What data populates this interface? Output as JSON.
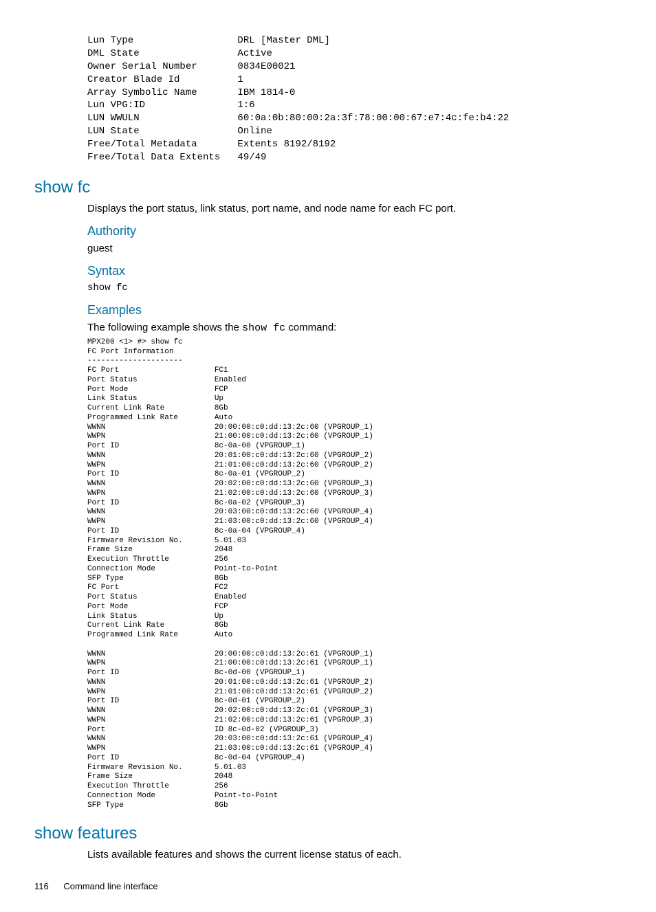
{
  "top_block": "Lun Type                  DRL [Master DML]\nDML State                 Active\nOwner Serial Number       0834E00021\nCreator Blade Id          1\nArray Symbolic Name       IBM 1814-0\nLun VPG:ID                1:6\nLUN WWULN                 60:0a:0b:80:00:2a:3f:78:00:00:67:e7:4c:fe:b4:22\nLUN State                 Online\nFree/Total Metadata       Extents 8192/8192\nFree/Total Data Extents   49/49",
  "show_fc": {
    "heading": "show fc",
    "desc": "Displays the port status, link status, port name, and node name for each FC port.",
    "authority_h": "Authority",
    "authority_v": "guest",
    "syntax_h": "Syntax",
    "syntax_v": "show fc",
    "examples_h": "Examples",
    "examples_intro_pre": "The following example shows the ",
    "examples_intro_code": "show fc",
    "examples_intro_post": " command:",
    "example_block": "MPX200 <1> #> show fc\nFC Port Information\n---------------------\nFC Port                     FC1\nPort Status                 Enabled\nPort Mode                   FCP\nLink Status                 Up\nCurrent Link Rate           8Gb\nProgrammed Link Rate        Auto\nWWNN                        20:00:00:c0:dd:13:2c:60 (VPGROUP_1)\nWWPN                        21:00:00:c0:dd:13:2c:60 (VPGROUP_1)\nPort ID                     8c-0a-00 (VPGROUP_1)\nWWNN                        20:01:00:c0:dd:13:2c:60 (VPGROUP_2)\nWWPN                        21:01:00:c0:dd:13:2c:60 (VPGROUP_2)\nPort ID                     8c-0a-01 (VPGROUP_2)\nWWNN                        20:02:00:c0:dd:13:2c:60 (VPGROUP_3)\nWWPN                        21:02:00:c0:dd:13:2c:60 (VPGROUP_3)\nPort ID                     8c-0a-02 (VPGROUP_3)\nWWNN                        20:03:00:c0:dd:13:2c:60 (VPGROUP_4)\nWWPN                        21:03:00:c0:dd:13:2c:60 (VPGROUP_4)\nPort ID                     8c-0a-04 (VPGROUP_4)\nFirmware Revision No.       5.01.03\nFrame Size                  2048\nExecution Throttle          256\nConnection Mode             Point-to-Point\nSFP Type                    8Gb\nFC Port                     FC2\nPort Status                 Enabled\nPort Mode                   FCP\nLink Status                 Up\nCurrent Link Rate           8Gb\nProgrammed Link Rate        Auto\n\nWWNN                        20:00:00:c0:dd:13:2c:61 (VPGROUP_1)\nWWPN                        21:00:00:c0:dd:13:2c:61 (VPGROUP_1)\nPort ID                     8c-0d-00 (VPGROUP_1)\nWWNN                        20:01:00:c0:dd:13:2c:61 (VPGROUP_2)\nWWPN                        21:01:00:c0:dd:13:2c:61 (VPGROUP_2)\nPort ID                     8c-0d-01 (VPGROUP_2)\nWWNN                        20:02:00:c0:dd:13:2c:61 (VPGROUP_3)\nWWPN                        21:02:00:c0:dd:13:2c:61 (VPGROUP_3)\nPort                        ID 8c-0d-02 (VPGROUP_3)\nWWNN                        20:03:00:c0:dd:13:2c:61 (VPGROUP_4)\nWWPN                        21:03:00:c0:dd:13:2c:61 (VPGROUP_4)\nPort ID                     8c-0d-04 (VPGROUP_4)\nFirmware Revision No.       5.01.03\nFrame Size                  2048\nExecution Throttle          256\nConnection Mode             Point-to-Point\nSFP Type                    8Gb"
  },
  "show_features": {
    "heading": "show features",
    "desc": "Lists available features and shows the current license status of each."
  },
  "footer": {
    "page": "116",
    "chapter": "Command line interface"
  }
}
